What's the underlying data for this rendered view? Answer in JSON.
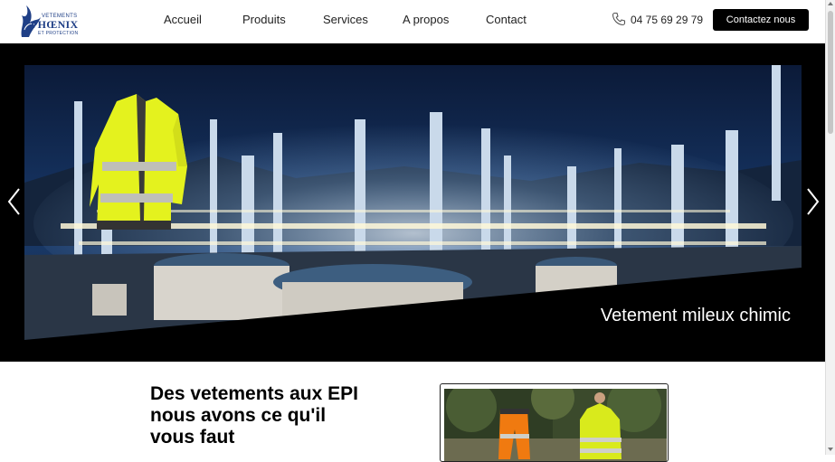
{
  "logo": {
    "top": "VETEMENTS",
    "main": "PHŒNIX",
    "sub": "ET PROTECTION"
  },
  "nav": {
    "items": [
      "Accueil",
      "Produits",
      "Services",
      "A propos",
      "Contact"
    ]
  },
  "header": {
    "phone": "04 75 69 29 79",
    "cta": "Contactez nous"
  },
  "hero": {
    "caption": "Vetement mileux chimic"
  },
  "intro": {
    "headline_lines": [
      "Des vetements aux EPI",
      "nous avons ce qu'il",
      "vous faut"
    ]
  },
  "icons": {
    "phone": "phone-icon",
    "prev": "chevron-left-icon",
    "next": "chevron-right-icon",
    "logo": "phoenix-bird-icon"
  }
}
